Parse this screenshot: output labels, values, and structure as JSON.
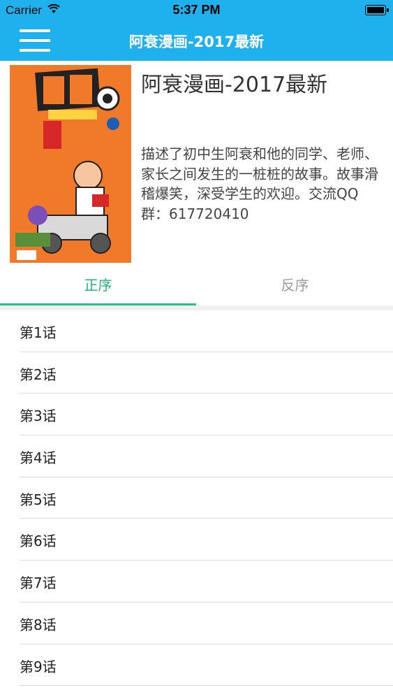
{
  "status_bar": {
    "carrier": "Carrier",
    "time": "5:37 PM"
  },
  "nav": {
    "title": "阿衰漫画-2017最新"
  },
  "comic": {
    "cover_alt": "阿衰 on line 7",
    "title": "阿衰漫画-2017最新",
    "description": "描述了初中生阿衰和他的同学、老师、家长之间发生的一桩桩的故事。故事滑稽爆笑，深受学生的欢迎。交流QQ群：617720410"
  },
  "tabs": {
    "ascending": "正序",
    "descending": "反序",
    "active": "ascending"
  },
  "chapters": [
    "第1话",
    "第2话",
    "第3话",
    "第4话",
    "第5话",
    "第6话",
    "第7话",
    "第8话",
    "第9话"
  ],
  "colors": {
    "bar": "#1fb1ee",
    "active_tab": "#1fb57c",
    "cover": "#f07a2a"
  }
}
